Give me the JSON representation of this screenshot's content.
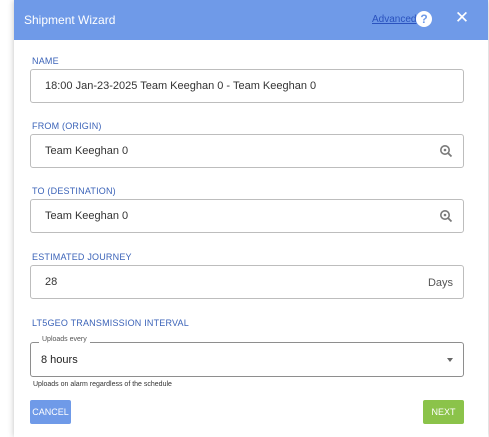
{
  "dialog": {
    "title": "Shipment Wizard",
    "advanced_link": "Advanced",
    "help_glyph": "?",
    "close_glyph": "✕"
  },
  "name": {
    "label": "NAME",
    "value": "18:00 Jan-23-2025 Team Keeghan 0 - Team Keeghan 0"
  },
  "from": {
    "label": "FROM (ORIGIN)",
    "value": "Team Keeghan 0",
    "icon": "location-search-icon"
  },
  "to": {
    "label": "TO (DESTINATION)",
    "value": "Team Keeghan 0",
    "icon": "location-search-icon"
  },
  "journey": {
    "label": "ESTIMATED JOURNEY",
    "value": "28",
    "unit": "Days"
  },
  "transmission": {
    "label": "LT5GEO TRANSMISSION INTERVAL",
    "select_legend": "Uploads every",
    "select_value": "8 hours",
    "hint": "Uploads on alarm regardless of the schedule"
  },
  "buttons": {
    "cancel": "CANCEL",
    "next": "NEXT"
  },
  "colors": {
    "header": "#6f9ae8",
    "label": "#3b63b8",
    "cancel": "#6f9ae8",
    "next": "#8bc34a"
  }
}
